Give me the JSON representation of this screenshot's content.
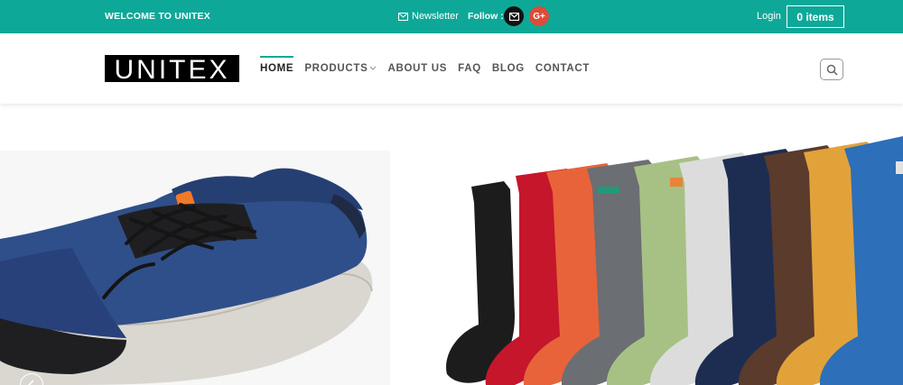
{
  "topbar": {
    "welcome": "WELCOME TO UNITEX",
    "newsletter": "Newsletter",
    "follow": "Follow :",
    "login": "Login",
    "cart": "0 items"
  },
  "header": {
    "logo_text": "UNITEX",
    "nav": [
      {
        "label": "HOME"
      },
      {
        "label": "PRODUCTS"
      },
      {
        "label": "ABOUT US"
      },
      {
        "label": "FAQ"
      },
      {
        "label": "BLOG"
      },
      {
        "label": "CONTACT"
      }
    ]
  },
  "icons": {
    "newsletter": "envelope-icon",
    "email": "email-icon",
    "google_plus": "google-plus-icon",
    "search": "search-icon",
    "products_dropdown": "chevron-down-icon",
    "slider_prev": "chevron-left-icon"
  },
  "social": {
    "google_plus_glyph": "G+"
  },
  "colors": {
    "brand": "#0ea898",
    "google_plus": "#dd4b39"
  }
}
